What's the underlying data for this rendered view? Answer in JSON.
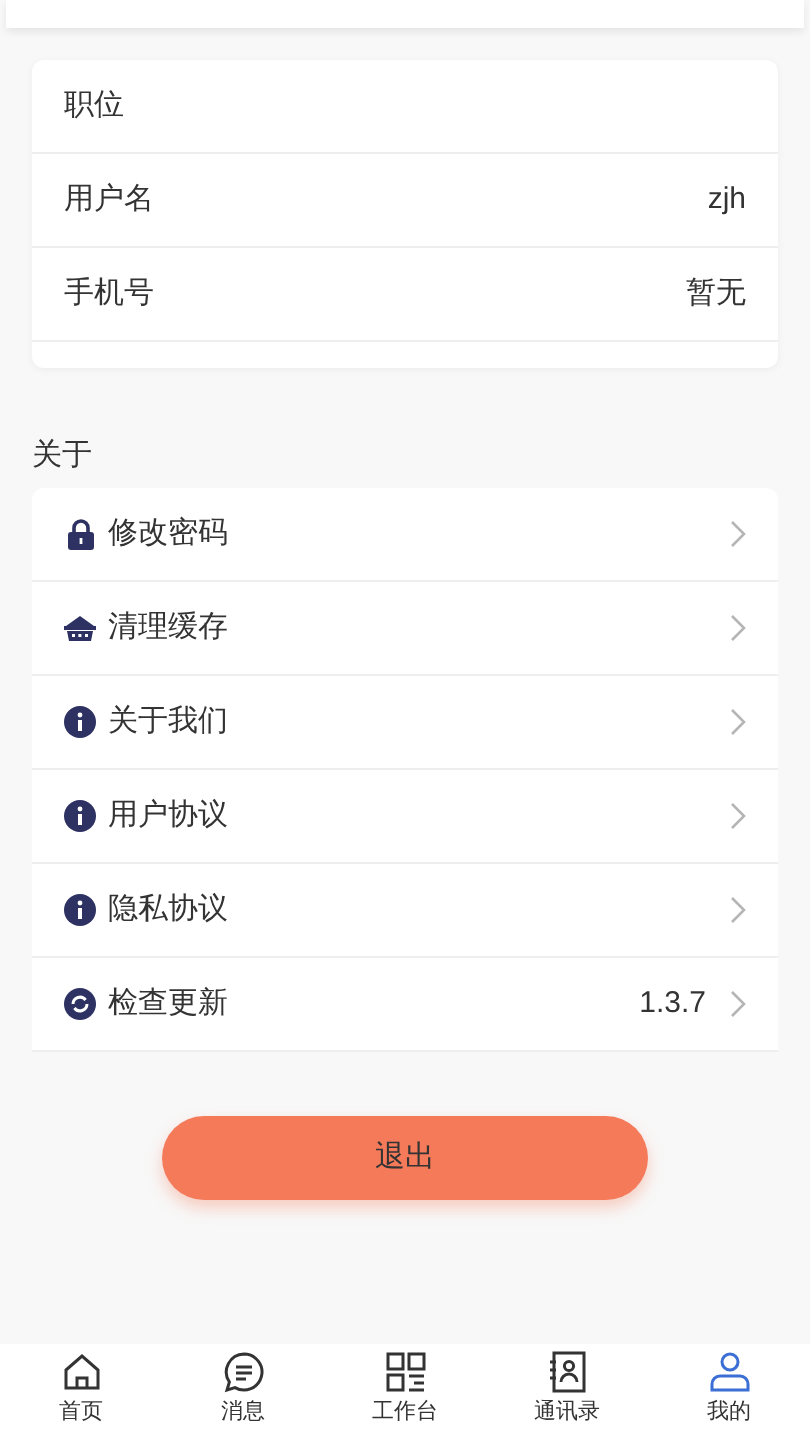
{
  "personal_info": [
    {
      "label": "职位"
    },
    {
      "label": "用户名",
      "value": "zjh"
    },
    {
      "label": "手机号",
      "value": "暂无"
    }
  ],
  "about": {
    "title": "关于",
    "items": [
      {
        "kind": "lock",
        "label": "修改密码"
      },
      {
        "kind": "basket",
        "label": "清理缓存"
      },
      {
        "kind": "info",
        "label": "关于我们"
      },
      {
        "kind": "info",
        "label": "用户协议"
      },
      {
        "kind": "info",
        "label": "隐私协议"
      },
      {
        "kind": "refresh",
        "label": "检查更新",
        "value": "1.3.7"
      }
    ]
  },
  "logout_button": "退出",
  "tab_bar": [
    {
      "kind": "home",
      "label": "首页",
      "selected": false
    },
    {
      "kind": "message",
      "label": "消息",
      "selected": false
    },
    {
      "kind": "grid",
      "label": "工作台",
      "selected": false
    },
    {
      "kind": "contacts",
      "label": "通讯录",
      "selected": false
    },
    {
      "kind": "user",
      "label": "我的",
      "selected": true
    }
  ]
}
